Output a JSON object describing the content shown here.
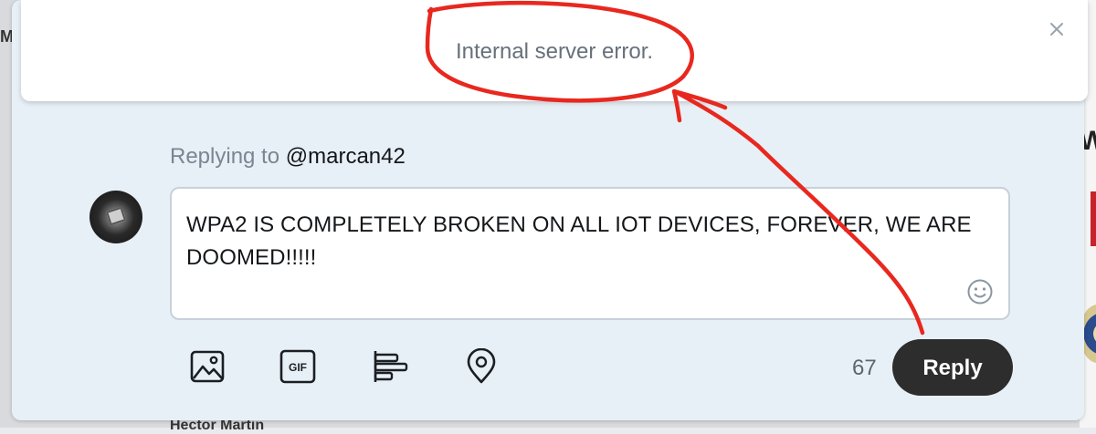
{
  "background": {
    "left_letter": "M",
    "right_letter": "W",
    "bottom_text": "Hector Martin"
  },
  "toast": {
    "message": "Internal server error.",
    "close_icon": "close-icon"
  },
  "reply": {
    "replying_prefix": "Replying to",
    "replying_handle": "@marcan42",
    "composer_text": "WPA2 IS COMPLETELY BROKEN ON ALL IOT DEVICES, FOREVER, WE ARE DOOMED!!!!!",
    "char_count": "67",
    "reply_button": "Reply",
    "toolbar_icons": [
      "image-icon",
      "gif-icon",
      "poll-icon",
      "location-icon"
    ],
    "emoji_icon": "emoji-icon"
  },
  "colors": {
    "accent_dark": "#2d2d2d",
    "annotation_red": "#e8281f",
    "modal_bg": "#e8f0f7"
  }
}
